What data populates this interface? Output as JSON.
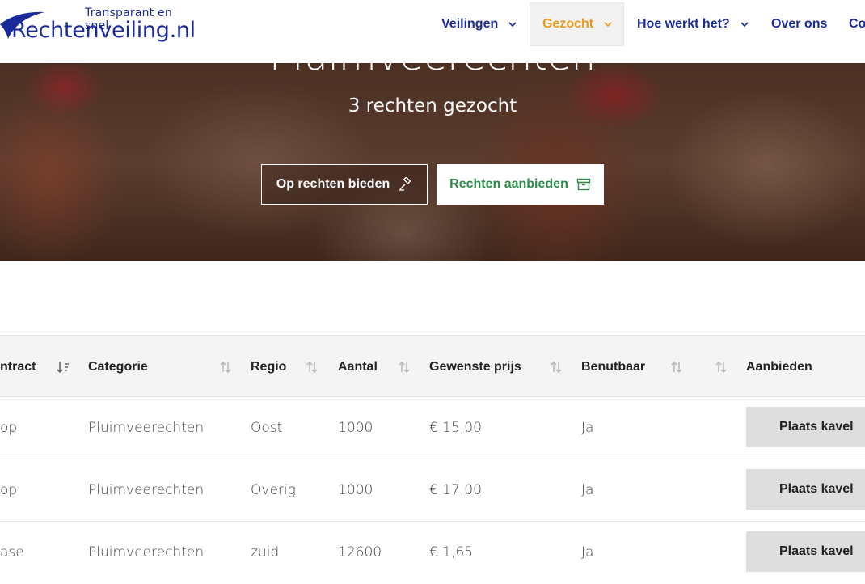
{
  "header": {
    "logo_tagline": "Transparant en snel",
    "logo_name": "Rechtenveiling.nl",
    "nav": [
      {
        "label": "Veilingen",
        "has_dropdown": true,
        "active": false
      },
      {
        "label": "Gezocht",
        "has_dropdown": true,
        "active": true
      },
      {
        "label": "Hoe werkt het?",
        "has_dropdown": true,
        "active": false
      },
      {
        "label": "Over ons",
        "has_dropdown": false,
        "active": false
      },
      {
        "label": "Co",
        "has_dropdown": false,
        "active": false
      }
    ]
  },
  "hero": {
    "title": "Pluimveerechten",
    "subtitle": "3 rechten gezocht",
    "bid_button": "Op rechten bieden",
    "offer_button": "Rechten aanbieden"
  },
  "table": {
    "columns": [
      "ntract",
      "Categorie",
      "Regio",
      "Aantal",
      "Gewenste prijs",
      "Benutbaar",
      "",
      "Aanbieden"
    ],
    "rows": [
      {
        "contract": "op",
        "categorie": "Pluimveerechten",
        "regio": "Oost",
        "aantal": "1000",
        "prijs": "€ 15,00",
        "benutbaar": "Ja",
        "action": "Plaats kavel"
      },
      {
        "contract": "op",
        "categorie": "Pluimveerechten",
        "regio": "Overig",
        "aantal": "1000",
        "prijs": "€ 17,00",
        "benutbaar": "Ja",
        "action": "Plaats kavel"
      },
      {
        "contract": "ase",
        "categorie": "Pluimveerechten",
        "regio": "zuid",
        "aantal": "12600",
        "prijs": "€ 1,65",
        "benutbaar": "Ja",
        "action": "Plaats kavel"
      }
    ]
  },
  "colors": {
    "brand_blue": "#1a2a9a",
    "active_orange": "#e89a1a",
    "offer_green": "#2e8a4a"
  }
}
